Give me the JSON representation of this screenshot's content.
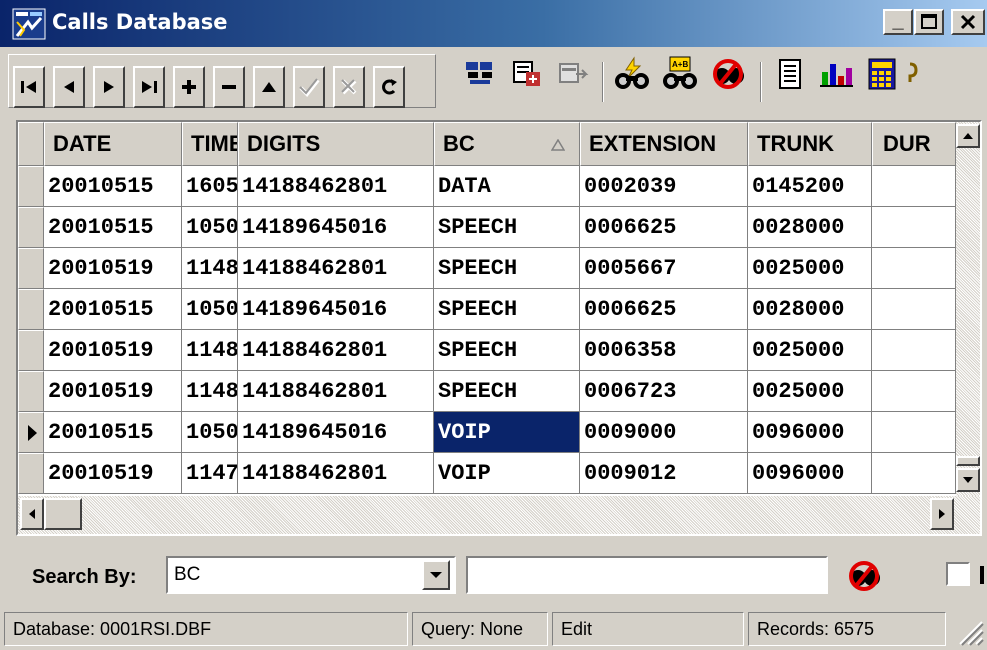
{
  "window": {
    "title": "Calls Database",
    "icon": "database-app-icon",
    "controls": [
      "minimize",
      "maximize",
      "close"
    ]
  },
  "toolbar": {
    "navigator": [
      "first-record",
      "prior-record",
      "next-record",
      "last-record",
      "insert-record",
      "delete-record",
      "edit-record",
      "post-edit",
      "cancel-edit",
      "refresh-data"
    ],
    "tools": [
      "find-icon",
      "copy-record-icon",
      "export-icon",
      "query-binoculars-icon",
      "advanced-query-icon",
      "clear-query-icon",
      "report-icon",
      "chart-icon",
      "calculator-icon"
    ]
  },
  "grid": {
    "columns": [
      "DATE",
      "TIME",
      "DIGITS",
      "BC",
      "EXTENSION",
      "TRUNK",
      "DUR"
    ],
    "sorted_column": "BC",
    "rows": [
      [
        "20010515",
        "1605",
        "14188462801",
        "DATA",
        "0002039",
        "0145200",
        ""
      ],
      [
        "20010515",
        "1050",
        "14189645016",
        "SPEECH",
        "0006625",
        "0028000",
        ""
      ],
      [
        "20010519",
        "1148",
        "14188462801",
        "SPEECH",
        "0005667",
        "0025000",
        ""
      ],
      [
        "20010515",
        "1050",
        "14189645016",
        "SPEECH",
        "0006625",
        "0028000",
        ""
      ],
      [
        "20010519",
        "1148",
        "14188462801",
        "SPEECH",
        "0006358",
        "0025000",
        ""
      ],
      [
        "20010519",
        "1148",
        "14188462801",
        "SPEECH",
        "0006723",
        "0025000",
        ""
      ],
      [
        "20010515",
        "1050",
        "14189645016",
        "VOIP",
        "0009000",
        "0096000",
        ""
      ],
      [
        "20010519",
        "1147",
        "14188462801",
        "VOIP",
        "0009012",
        "0096000",
        ""
      ]
    ],
    "current_row": 6,
    "selected_cell": [
      6,
      3
    ]
  },
  "search": {
    "label": "Search By:",
    "field_value": "BC",
    "text_value": ""
  },
  "status": {
    "database": "Database: 0001RSI.DBF",
    "query": "Query: None",
    "mode": "Edit",
    "records": "Records: 6575"
  },
  "colors": {
    "selection": "#0a246a",
    "face": "#d4d0c8",
    "title_start": "#0a246a",
    "title_end": "#a6caf0"
  }
}
